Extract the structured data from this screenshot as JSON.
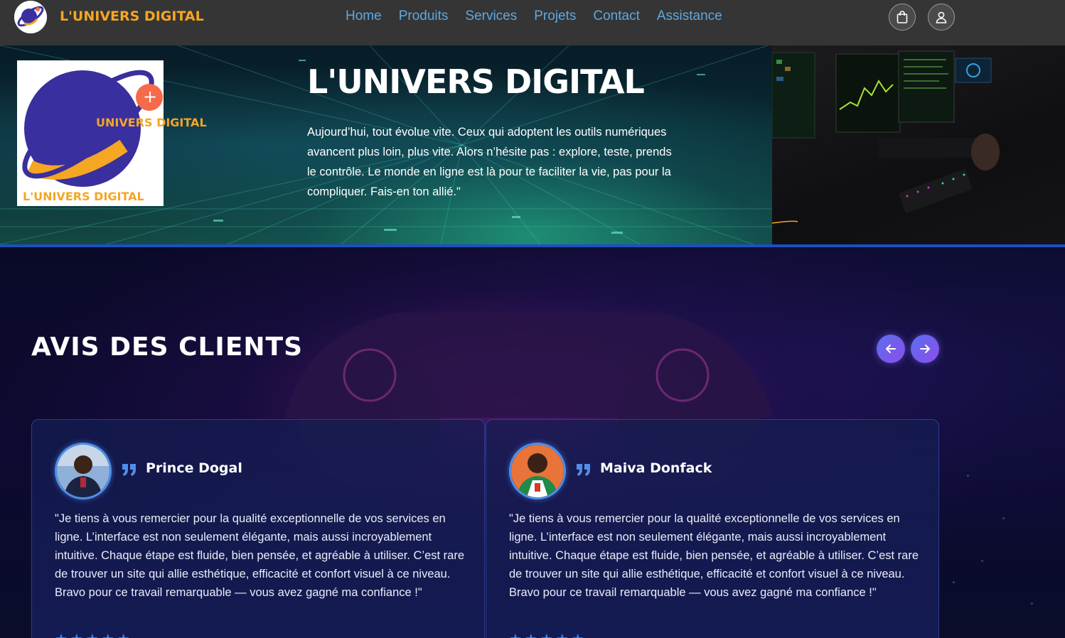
{
  "navbar": {
    "brand": "L'UNIVERS DIGITAL",
    "links": [
      "Home",
      "Produits",
      "Services",
      "Projets",
      "Contact",
      "Assistance"
    ],
    "icons": [
      "shopping-bag-icon",
      "user-icon"
    ]
  },
  "hero": {
    "logo_text_top": "UNIVERS DIGITAL",
    "logo_text_bottom": "L'UNIVERS DIGITAL",
    "logo_plus": "+",
    "title": "L'UNIVERS DIGITAL",
    "text": "Aujourd’hui, tout évolue vite. Ceux qui adoptent les outils numériques avancent plus loin, plus vite. Alors n’hésite pas : explore, teste, prends le contrôle. Le monde en ligne est là pour te faciliter la vie, pas pour la compliquer. Fais-en ton allié.\""
  },
  "reviews": {
    "title": "AVIS DES CLIENTS",
    "prev_icon": "arrow-left-icon",
    "next_icon": "arrow-right-icon",
    "items": [
      {
        "name": "Prince Dogal",
        "text": "\"Je tiens à vous remercier pour la qualité exceptionnelle de vos services en ligne. L’interface est non seulement élégante, mais aussi incroyablement intuitive. Chaque étape est fluide, bien pensée, et agréable à utiliser. C’est rare de trouver un site qui allie esthétique, efficacité et confort visuel à ce niveau. Bravo pour ce travail remarquable — vous avez gagné ma confiance !\"",
        "stars": "★★★★★",
        "rating": 5
      },
      {
        "name": "Maiva Donfack",
        "text": "\"Je tiens à vous remercier pour la qualité exceptionnelle de vos services en ligne. L’interface est non seulement élégante, mais aussi incroyablement intuitive. Chaque étape est fluide, bien pensée, et agréable à utiliser. C’est rare de trouver un site qui allie esthétique, efficacité et confort visuel à ce niveau. Bravo pour ce travail remarquable — vous avez gagné ma confiance !\"",
        "stars": "★★★★★",
        "rating": 5
      }
    ]
  },
  "colors": {
    "brand_orange": "#f5a623",
    "nav_link": "#5fa8e0",
    "accent_blue": "#1e4fc2",
    "planet_purple": "#3a2f9e"
  }
}
